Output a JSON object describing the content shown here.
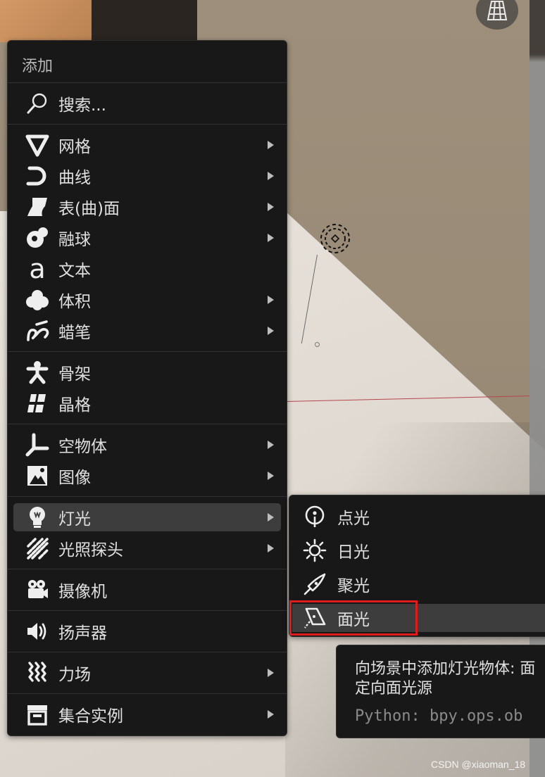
{
  "add_menu": {
    "title": "添加",
    "search": {
      "label": "搜索...",
      "icon": "search-icon"
    },
    "items": [
      {
        "label": "网格",
        "icon": "mesh-icon",
        "submenu": true
      },
      {
        "label": "曲线",
        "icon": "curve-icon",
        "submenu": true
      },
      {
        "label": "表(曲)面",
        "icon": "surface-icon",
        "submenu": true
      },
      {
        "label": "融球",
        "icon": "metaball-icon",
        "submenu": true
      },
      {
        "label": "文本",
        "icon": "text-icon",
        "submenu": false
      },
      {
        "label": "体积",
        "icon": "volume-icon",
        "submenu": true
      },
      {
        "label": "蜡笔",
        "icon": "grease-pencil-icon",
        "submenu": true
      },
      {
        "label": "骨架",
        "icon": "armature-icon",
        "submenu": false
      },
      {
        "label": "晶格",
        "icon": "lattice-icon",
        "submenu": false
      },
      {
        "label": "空物体",
        "icon": "empty-icon",
        "submenu": true
      },
      {
        "label": "图像",
        "icon": "image-icon",
        "submenu": true
      },
      {
        "label": "灯光",
        "icon": "light-bulb-icon",
        "submenu": true,
        "active": true
      },
      {
        "label": "光照探头",
        "icon": "light-probe-icon",
        "submenu": true
      },
      {
        "label": "摄像机",
        "icon": "camera-icon",
        "submenu": false
      },
      {
        "label": "扬声器",
        "icon": "speaker-icon",
        "submenu": false
      },
      {
        "label": "力场",
        "icon": "force-field-icon",
        "submenu": true
      },
      {
        "label": "集合实例",
        "icon": "collection-instance-icon",
        "submenu": true
      }
    ]
  },
  "light_submenu": {
    "items": [
      {
        "label": "点光",
        "icon": "point-light-icon"
      },
      {
        "label": "日光",
        "icon": "sun-light-icon"
      },
      {
        "label": "聚光",
        "icon": "spot-light-icon"
      },
      {
        "label": "面光",
        "icon": "area-light-icon",
        "active": true
      }
    ]
  },
  "tooltip": {
    "description": "向场景中添加灯光物体: 面\n定向面光源",
    "python": "Python: bpy.ops.ob"
  },
  "watermark": "CSDN @xiaoman_18",
  "colors": {
    "highlight": "#e01b1b",
    "menu_bg": "#181818",
    "active_bg": "#3d3d3d"
  }
}
